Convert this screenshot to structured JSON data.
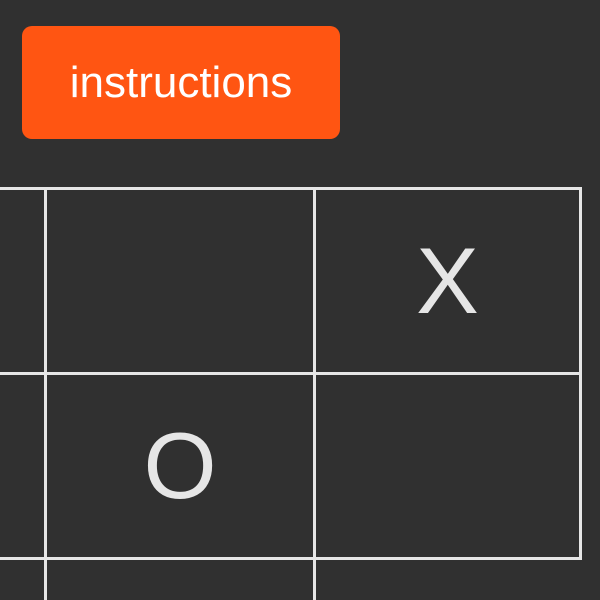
{
  "toolbar": {
    "instructions_label": "instructions"
  },
  "board": {
    "rows": [
      [
        "",
        "",
        "X"
      ],
      [
        "",
        "O",
        ""
      ],
      [
        "",
        "",
        ""
      ]
    ]
  },
  "colors": {
    "background": "#303030",
    "accent": "#ff5512",
    "grid": "#e6e6e6",
    "mark": "#e6e6e6"
  }
}
